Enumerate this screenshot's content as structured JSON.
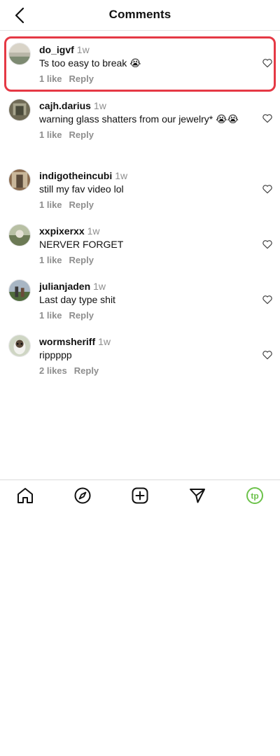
{
  "header": {
    "title": "Comments",
    "back_icon": "chevron-left-icon"
  },
  "comments": [
    {
      "username": "do_igvf",
      "time": "1w",
      "text": "Ts too easy to break 😭",
      "likes": "1 like",
      "reply": "Reply",
      "highlighted": true
    },
    {
      "username": "cajh.darius",
      "time": "1w",
      "text": "warning glass shatters from our jewelry* 😭😭",
      "likes": "1 like",
      "reply": "Reply"
    },
    {
      "username": "indigotheincubi",
      "time": "1w",
      "text": "still my fav video lol",
      "likes": "1 like",
      "reply": "Reply"
    },
    {
      "username": "xxpixerxx",
      "time": "1w",
      "text": "NERVER FORGET",
      "likes": "1 like",
      "reply": "Reply"
    },
    {
      "username": "julianjaden",
      "time": "1w",
      "text": "Last day type shit",
      "likes": "1 like",
      "reply": "Reply"
    },
    {
      "username": "wormsheriff",
      "time": "1w",
      "text": "rippppp",
      "likes": "2 likes",
      "reply": "Reply"
    }
  ],
  "tabbar": {
    "items": [
      {
        "icon": "home-icon"
      },
      {
        "icon": "explore-compass-icon"
      },
      {
        "icon": "create-plus-icon"
      },
      {
        "icon": "send-paper-plane-icon"
      },
      {
        "icon": "profile-avatar-icon",
        "label": "tp",
        "accent": "#6cc24a"
      }
    ]
  },
  "colors": {
    "highlight_border": "#e53945",
    "muted_text": "#8e8e8e"
  }
}
